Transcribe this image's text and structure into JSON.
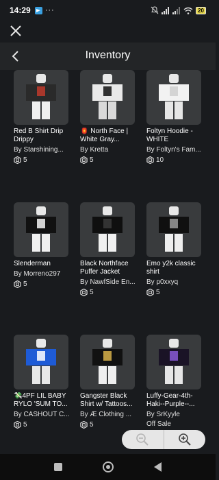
{
  "status": {
    "time": "14:29",
    "battery": "20",
    "dots": "···"
  },
  "header": {
    "title": "Inventory"
  },
  "items": [
    {
      "name": "Red B Shirt Drip Drippy",
      "creator": "By Starshining...",
      "price": "5",
      "offsale": "",
      "torso": "#2a2a2a",
      "accent": "#c0392b",
      "legs": "#f0f0f0"
    },
    {
      "name": "🏮 North Face | White Gray...",
      "creator": "By Kretta",
      "price": "5",
      "offsale": "",
      "torso": "#e9e9e9",
      "accent": "#111111",
      "legs": "#d9d9d9"
    },
    {
      "name": "Foltyn Hoodie - WHITE",
      "creator": "By Foltyn's Fam...",
      "price": "10",
      "offsale": "",
      "torso": "#f2f2f2",
      "accent": "#cfcfcf",
      "legs": "#e6e6e6"
    },
    {
      "name": "Slenderman",
      "creator": "By Morreno297",
      "price": "5",
      "offsale": "",
      "torso": "#111111",
      "accent": "#f5f5f5",
      "legs": "#f0f0f0"
    },
    {
      "name": "Black Northface Puffer Jacket",
      "creator": "By NawfSide En...",
      "price": "5",
      "offsale": "",
      "torso": "#0f0f0f",
      "accent": "#3a3a3a",
      "legs": "#f0f0f0"
    },
    {
      "name": "Emo y2k classic shirt",
      "creator": "By p0xxyq",
      "price": "5",
      "offsale": "",
      "torso": "#101010",
      "accent": "#9a9a9a",
      "legs": "#eeeeee"
    },
    {
      "name": "💸4PF LIL BABY RYLO 'SUM TO...",
      "creator": "By CASHOUT C...",
      "price": "5",
      "offsale": "",
      "torso": "#1e5bd6",
      "accent": "#ffffff",
      "legs": "#e8e8e8"
    },
    {
      "name": "Gangster Black Shirt w/ Tattoos...",
      "creator": "By Æ Clothing ...",
      "price": "5",
      "offsale": "",
      "torso": "#111111",
      "accent": "#d8b24a",
      "legs": "#eeeeee"
    },
    {
      "name": "Luffy-Gear-4th-Haki--Purple--...",
      "creator": "By SrKyyle",
      "price": "",
      "offsale": "Off Sale",
      "torso": "#1a1326",
      "accent": "#8a5ad6",
      "legs": "#e6e6e6"
    }
  ],
  "colors": {
    "background": "#191b1e",
    "card": "#393b3d",
    "header": "#232527"
  },
  "icons": {
    "close": "close-icon",
    "back": "back-arrow-icon",
    "robux": "robux-icon",
    "zoom_out": "zoom-out-icon",
    "zoom_in": "zoom-in-icon"
  }
}
